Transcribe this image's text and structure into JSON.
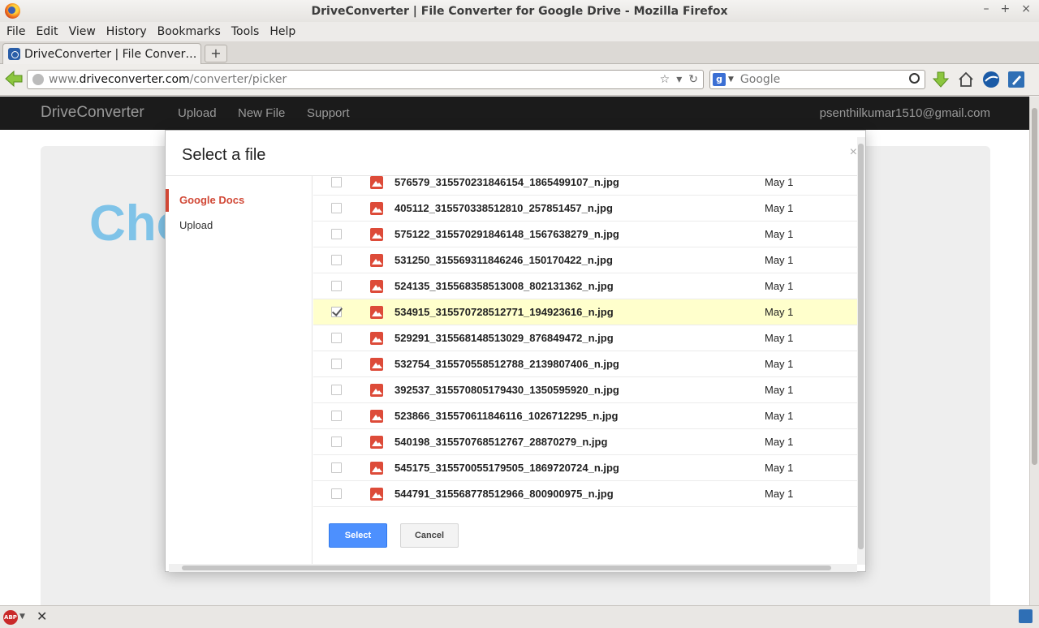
{
  "window": {
    "title": "DriveConverter | File Converter for Google Drive - Mozilla Firefox",
    "controls": [
      "–",
      "+",
      "×"
    ]
  },
  "menu": [
    "File",
    "Edit",
    "View",
    "History",
    "Bookmarks",
    "Tools",
    "Help"
  ],
  "tab": {
    "title": "DriveConverter | File Converte…",
    "new_tab": "+"
  },
  "url": {
    "prefix": "www.",
    "host": "driveconverter.com",
    "path": "/converter/picker"
  },
  "search": {
    "placeholder": "Google",
    "engine": "g"
  },
  "site": {
    "brand": "DriveConverter",
    "links": [
      "Upload",
      "New File",
      "Support"
    ],
    "email": "psenthilkumar1510@gmail.com",
    "hero": "Cho"
  },
  "dialog": {
    "title": "Select a file",
    "close": "×",
    "sidebar": [
      {
        "label": "Google Docs",
        "active": true
      },
      {
        "label": "Upload",
        "active": false
      }
    ],
    "files": [
      {
        "name": "576579_315570231846154_1865499107_n.jpg",
        "date": "May 1",
        "checked": false
      },
      {
        "name": "405112_315570338512810_257851457_n.jpg",
        "date": "May 1",
        "checked": false
      },
      {
        "name": "575122_315570291846148_1567638279_n.jpg",
        "date": "May 1",
        "checked": false
      },
      {
        "name": "531250_315569311846246_150170422_n.jpg",
        "date": "May 1",
        "checked": false
      },
      {
        "name": "524135_315568358513008_802131362_n.jpg",
        "date": "May 1",
        "checked": false
      },
      {
        "name": "534915_315570728512771_194923616_n.jpg",
        "date": "May 1",
        "checked": true
      },
      {
        "name": "529291_315568148513029_876849472_n.jpg",
        "date": "May 1",
        "checked": false
      },
      {
        "name": "532754_315570558512788_2139807406_n.jpg",
        "date": "May 1",
        "checked": false
      },
      {
        "name": "392537_315570805179430_1350595920_n.jpg",
        "date": "May 1",
        "checked": false
      },
      {
        "name": "523866_315570611846116_1026712295_n.jpg",
        "date": "May 1",
        "checked": false
      },
      {
        "name": "540198_315570768512767_28870279_n.jpg",
        "date": "May 1",
        "checked": false
      },
      {
        "name": "545175_315570055179505_1869720724_n.jpg",
        "date": "May 1",
        "checked": false
      },
      {
        "name": "544791_315568778512966_800900975_n.jpg",
        "date": "May 1",
        "checked": false
      }
    ],
    "select_label": "Select",
    "cancel_label": "Cancel"
  },
  "status": {
    "abp": "ABP",
    "close": "✕"
  },
  "colors": {
    "accent": "#4d90fe",
    "active_side": "#d14836",
    "selected_row": "#ffffcc",
    "hero_text": "#7fc3e8"
  }
}
